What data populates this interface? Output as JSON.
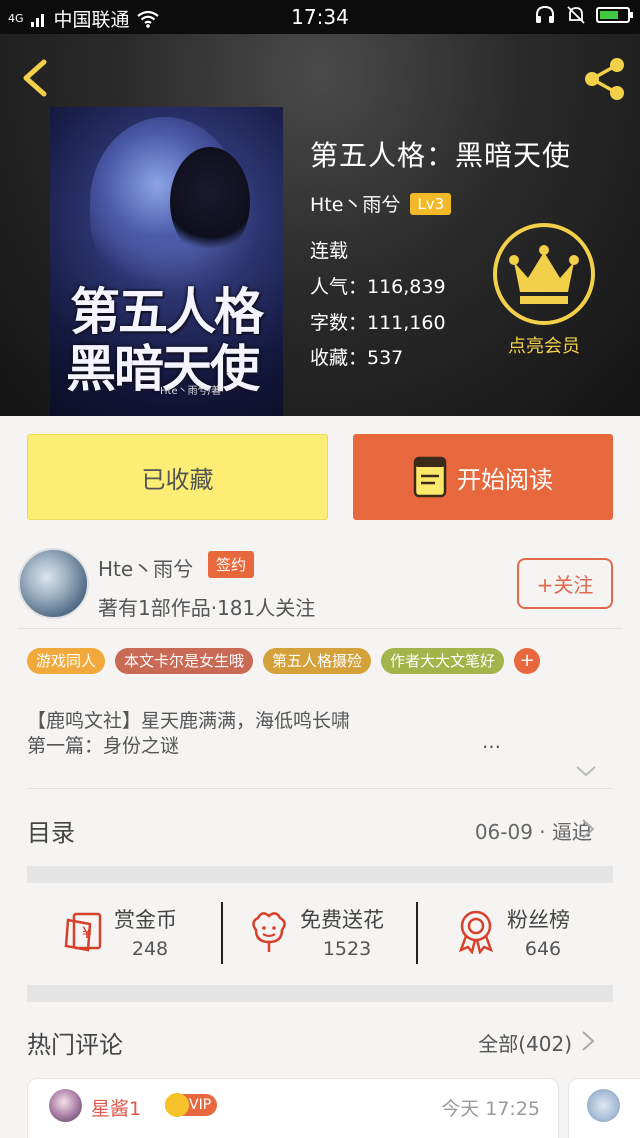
{
  "status_bar": {
    "carrier": "中国联通",
    "signal_label": "4G",
    "time": "17:34"
  },
  "book": {
    "title": "第五人格：黑暗天使",
    "author": "Hte丶雨兮",
    "level": "Lv3",
    "status": "连载",
    "popularity": "人气：116,839",
    "words": "字数：111,160",
    "favorites": "收藏：537",
    "cover_title_line1": "第五人格",
    "cover_title_line2": "黑暗天使",
    "cover_author": "Hte丶雨兮/著"
  },
  "vip": {
    "label": "点亮会员"
  },
  "actions": {
    "favorited_label": "已收藏",
    "read_label": "开始阅读"
  },
  "author_row": {
    "name": "Hte丶雨兮",
    "sign_badge": "签约",
    "stats": "著有1部作品·181人关注",
    "follow_label": "+关注"
  },
  "tags": [
    {
      "label": "游戏同人",
      "color": "#f2a93b"
    },
    {
      "label": "本文卡尔是女生哦",
      "color": "#c96a55"
    },
    {
      "label": "第五人格摄殓",
      "color": "#d4a13a"
    },
    {
      "label": "作者大大文笔好",
      "color": "#a3b54a"
    }
  ],
  "tag_add": "+",
  "description": {
    "line1": "【鹿鸣文社】星天鹿满满，海低鸣长啸",
    "line2": "第一篇：身份之谜",
    "ellipsis": "…"
  },
  "toc": {
    "title": "目录",
    "latest": "06-09 · 逼迫"
  },
  "stats": {
    "reward": {
      "label": "赏金币",
      "value": "248"
    },
    "flower": {
      "label": "免费送花",
      "value": "1523"
    },
    "fans": {
      "label": "粉丝榜",
      "value": "646"
    }
  },
  "comments": {
    "title": "热门评论",
    "all_label": "全部(402)",
    "first": {
      "user": "星酱1",
      "badge": "VIP",
      "time": "今天 17:25"
    }
  },
  "colors": {
    "accent_orange": "#e8683d",
    "fav_yellow": "#fcee75",
    "vip_gold": "#f3d04a"
  }
}
